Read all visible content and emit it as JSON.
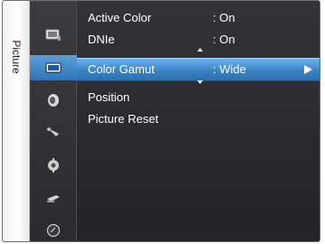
{
  "sidebar": {
    "tab_label": "Picture",
    "icons": [
      {
        "name": "monitor-icon"
      },
      {
        "name": "picture-icon",
        "selected": true
      },
      {
        "name": "sound-icon"
      },
      {
        "name": "channel-icon"
      },
      {
        "name": "setup-icon"
      },
      {
        "name": "input-icon"
      },
      {
        "name": "application-icon"
      }
    ]
  },
  "menu": {
    "items": [
      {
        "label": "Active Color",
        "value": ": On"
      },
      {
        "label": "DNIe",
        "value": ": On"
      },
      {
        "label": "Color Gamut",
        "value": ": Wide",
        "selected": true
      },
      {
        "label": "Position",
        "value": ""
      },
      {
        "label": "Picture Reset",
        "value": ""
      }
    ]
  },
  "colors": {
    "highlight": "#3a83c6",
    "background": "#2c2c2f",
    "text": "#ffffff"
  }
}
